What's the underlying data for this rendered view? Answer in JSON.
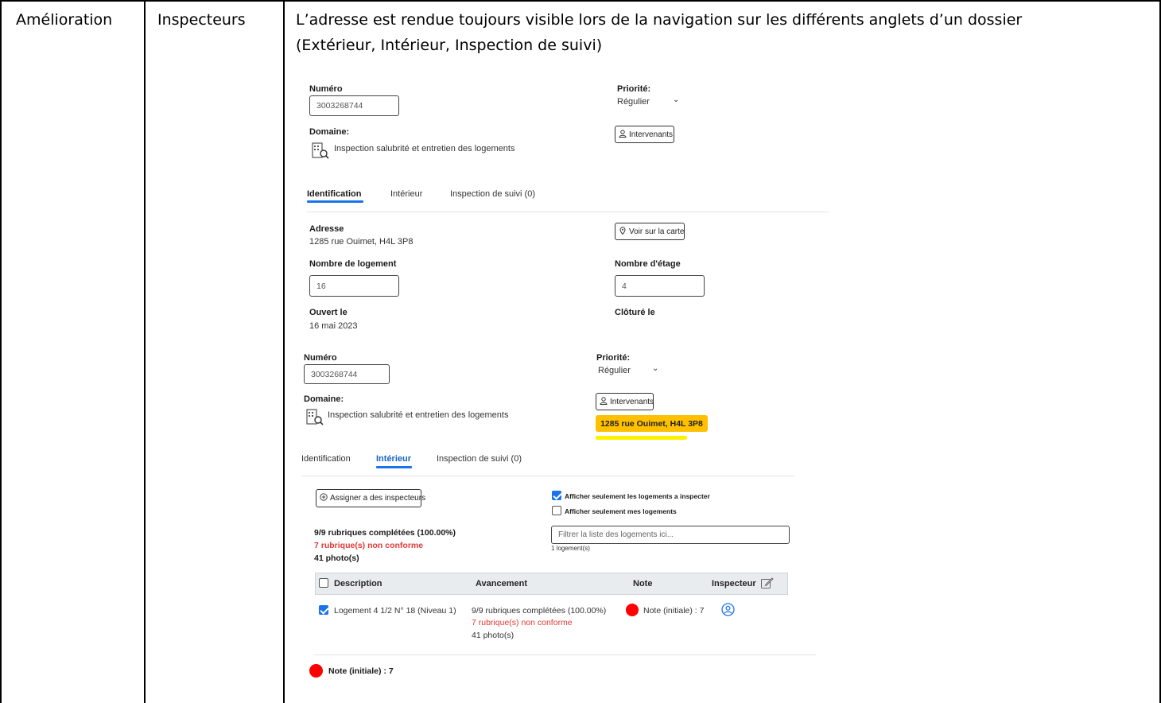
{
  "row": {
    "type": "Amélioration",
    "role": "Inspecteurs",
    "description_line1": "L’adresse est rendue toujours visible lors de la navigation sur les différents anglets d’un dossier",
    "description_line2": "(Extérieur, Intérieur, Inspection de suivi)"
  },
  "screen1": {
    "numero_label": "Numéro",
    "numero_value": "3003268744",
    "priorite_label": "Priorité:",
    "priorite_value": "Régulier",
    "domaine_label": "Domaine:",
    "domaine_value": "Inspection salubrité et entretien des logements",
    "intervenants_button": "Intervenants",
    "tabs": [
      "Identification",
      "Intérieur",
      "Inspection de suivi (0)"
    ],
    "active_tab": "Identification",
    "adresse_label": "Adresse",
    "adresse_value": "1285 rue Ouimet, H4L 3P8",
    "voir_carte_button": "Voir sur la carte",
    "nb_logement_label": "Nombre de logement",
    "nb_logement_value": "16",
    "nb_etage_label": "Nombre d'étage",
    "nb_etage_value": "4",
    "ouvert_label": "Ouvert le",
    "ouvert_value": "16 mai 2023",
    "cloture_label": "Clôturé le"
  },
  "screen2": {
    "numero_label": "Numéro",
    "numero_value": "3003268744",
    "priorite_label": "Priorité:",
    "priorite_value": "Régulier",
    "domaine_label": "Domaine:",
    "domaine_value": "Inspection salubrité et entretien des logements",
    "intervenants_button": "Intervenants",
    "address_highlight": "1285 rue Ouimet, H4L 3P8",
    "highlight_color": "#ffc000",
    "tabs": [
      "Identification",
      "Intérieur",
      "Inspection de suivi (0)"
    ],
    "active_tab": "Intérieur",
    "assign_button": "Assigner a des inspecteurs",
    "filter1_label": "Afficher seulement les logements a inspecter",
    "filter1_checked": true,
    "filter2_label": "Afficher seulement mes logements",
    "filter2_checked": false,
    "summary_completed": "9/9 rubriques complétées (100.00%)",
    "summary_nonconform": "7 rubrique(s) non conforme",
    "summary_photos": "41 photo(s)",
    "filter_placeholder": "Filtrer la liste des logements ici...",
    "logement_count": "1 logement(s)",
    "table_headers": [
      "Description",
      "Avancement",
      "Note",
      "Inspecteur"
    ],
    "row_description": "Logement 4 1/2 N° 18 (Niveau 1)",
    "row_avancement": "9/9 rubriques complétées (100.00%)",
    "row_nonconform": "7 rubrique(s) non conforme",
    "row_photos": "41 photo(s)",
    "row_note": "Note (initiale) : 7",
    "footer_note": "Note (initiale) : 7",
    "note_color": "#ff0000"
  }
}
